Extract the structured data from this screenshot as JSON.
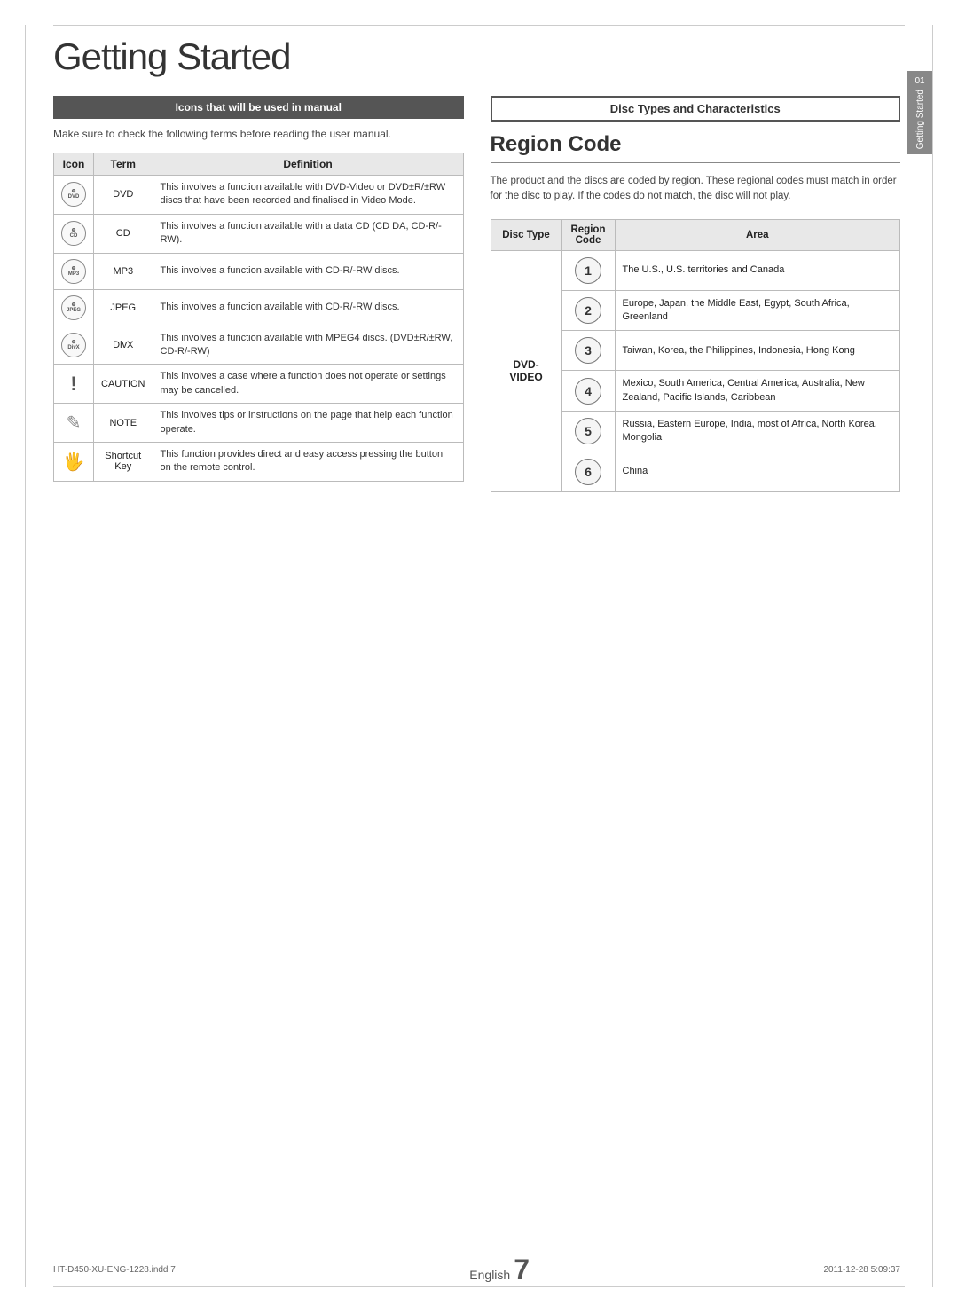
{
  "page": {
    "title": "Getting Started",
    "side_tab": {
      "number": "01",
      "label": "Getting Started"
    },
    "footer": {
      "left": "HT-D450-XU-ENG-1228.indd  7",
      "right": "2011-12-28   5:09:37",
      "page_word": "English",
      "page_number": "7"
    }
  },
  "left_section": {
    "header": "Icons that will be used in manual",
    "intro": "Make sure to check the following terms before reading the user manual.",
    "table": {
      "columns": [
        "Icon",
        "Term",
        "Definition"
      ],
      "rows": [
        {
          "icon_label": "DVD",
          "term": "DVD",
          "definition": "This involves a function available with DVD-Video or DVD±R/±RW discs that have been recorded and finalised in Video Mode."
        },
        {
          "icon_label": "CD",
          "term": "CD",
          "definition": "This involves a function available with a data CD (CD DA, CD-R/-RW)."
        },
        {
          "icon_label": "MP3",
          "term": "MP3",
          "definition": "This involves a function available with CD-R/-RW discs."
        },
        {
          "icon_label": "JPEG",
          "term": "JPEG",
          "definition": "This involves a function available with CD-R/-RW discs."
        },
        {
          "icon_label": "DivX",
          "term": "DivX",
          "definition": "This involves a function available with MPEG4 discs. (DVD±R/±RW, CD-R/-RW)"
        },
        {
          "icon_label": "!",
          "term": "CAUTION",
          "definition": "This involves a case where a function does not operate or settings may be cancelled."
        },
        {
          "icon_label": "✎",
          "term": "NOTE",
          "definition": "This involves tips or instructions on the page that help each function operate."
        },
        {
          "icon_label": "⌂",
          "term": "Shortcut Key",
          "definition": "This function provides direct and easy access pressing the button on the remote control."
        }
      ]
    }
  },
  "right_section": {
    "header": "Disc Types and Characteristics",
    "region_code": {
      "title": "Region Code",
      "intro": "The product and the discs are coded by region. These regional codes must match in order for the disc to play. If the codes do not match, the disc will not play.",
      "table": {
        "columns": [
          "Disc Type",
          "Region Code",
          "Area"
        ],
        "disc_type_label": "DVD-VIDEO",
        "rows": [
          {
            "number": "1",
            "area": "The U.S., U.S. territories and Canada"
          },
          {
            "number": "2",
            "area": "Europe, Japan, the Middle East, Egypt, South Africa, Greenland"
          },
          {
            "number": "3",
            "area": "Taiwan, Korea, the Philippines, Indonesia, Hong Kong"
          },
          {
            "number": "4",
            "area": "Mexico, South America, Central America, Australia, New Zealand, Pacific Islands, Caribbean"
          },
          {
            "number": "5",
            "area": "Russia, Eastern Europe, India, most of Africa, North Korea, Mongolia"
          },
          {
            "number": "6",
            "area": "China"
          }
        ]
      }
    }
  }
}
